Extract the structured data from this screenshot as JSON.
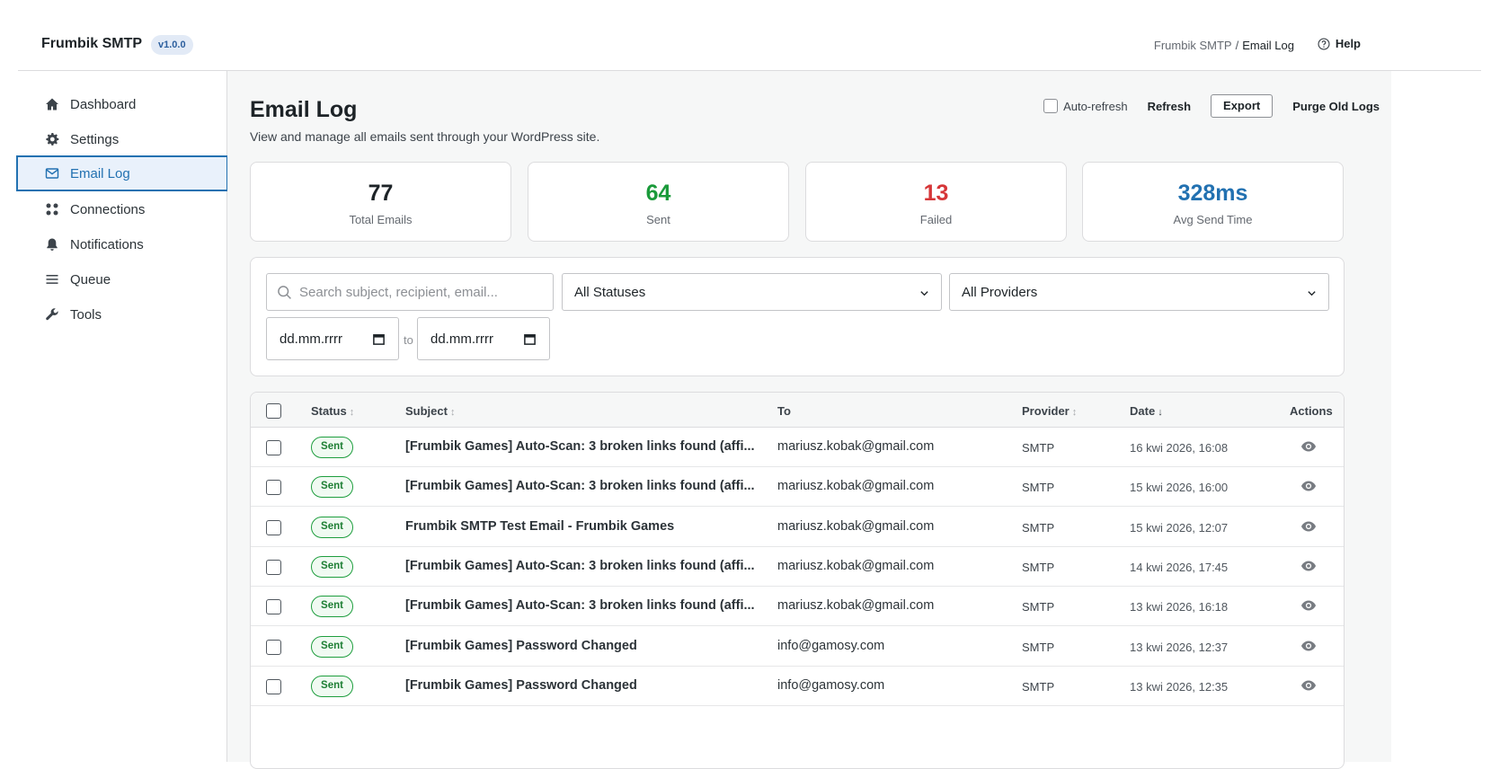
{
  "header": {
    "brand": "Frumbik SMTP",
    "version": "v1.0.0",
    "breadcrumb_root": "Frumbik SMTP",
    "breadcrumb_sep": "/",
    "breadcrumb_current": "Email Log",
    "help": "Help"
  },
  "sidebar": {
    "items": [
      {
        "label": "Dashboard",
        "icon": "home-icon"
      },
      {
        "label": "Settings",
        "icon": "gear-icon"
      },
      {
        "label": "Email Log",
        "icon": "envelope-icon",
        "active": true
      },
      {
        "label": "Connections",
        "icon": "connections-icon"
      },
      {
        "label": "Notifications",
        "icon": "bell-icon"
      },
      {
        "label": "Queue",
        "icon": "list-icon"
      },
      {
        "label": "Tools",
        "icon": "wrench-icon"
      }
    ]
  },
  "page": {
    "title": "Email Log",
    "subtitle": "View and manage all emails sent through your WordPress site.",
    "auto_refresh": "Auto-refresh",
    "refresh": "Refresh",
    "export": "Export",
    "purge": "Purge Old Logs"
  },
  "stats": [
    {
      "value": "77",
      "label": "Total Emails",
      "color": "#1d2327"
    },
    {
      "value": "64",
      "label": "Sent",
      "color": "#1a9a3a"
    },
    {
      "value": "13",
      "label": "Failed",
      "color": "#d63638"
    },
    {
      "value": "328ms",
      "label": "Avg Send Time",
      "color": "#2271b1"
    }
  ],
  "filters": {
    "search_placeholder": "Search subject, recipient, email...",
    "status": "All Statuses",
    "provider": "All Providers",
    "date_from": "dd.mm.rrrr",
    "date_to": "dd.mm.rrrr",
    "to_label": "to"
  },
  "table": {
    "headers": {
      "status": "Status",
      "subject": "Subject",
      "to": "To",
      "provider": "Provider",
      "date": "Date",
      "actions": "Actions",
      "sort_neutral": "↕",
      "sort_desc": "↓"
    },
    "rows": [
      {
        "status": "Sent",
        "subject": "[Frumbik Games] Auto-Scan: 3 broken links found (affi...",
        "to": "mariusz.kobak@gmail.com",
        "provider": "SMTP",
        "date": "16 kwi 2026, 16:08"
      },
      {
        "status": "Sent",
        "subject": "[Frumbik Games] Auto-Scan: 3 broken links found (affi...",
        "to": "mariusz.kobak@gmail.com",
        "provider": "SMTP",
        "date": "15 kwi 2026, 16:00"
      },
      {
        "status": "Sent",
        "subject": "Frumbik SMTP Test Email - Frumbik Games",
        "to": "mariusz.kobak@gmail.com",
        "provider": "SMTP",
        "date": "15 kwi 2026, 12:07"
      },
      {
        "status": "Sent",
        "subject": "[Frumbik Games] Auto-Scan: 3 broken links found (affi...",
        "to": "mariusz.kobak@gmail.com",
        "provider": "SMTP",
        "date": "14 kwi 2026, 17:45"
      },
      {
        "status": "Sent",
        "subject": "[Frumbik Games] Auto-Scan: 3 broken links found (affi...",
        "to": "mariusz.kobak@gmail.com",
        "provider": "SMTP",
        "date": "13 kwi 2026, 16:18"
      },
      {
        "status": "Sent",
        "subject": "[Frumbik Games] Password Changed",
        "to": "info@gamosy.com",
        "provider": "SMTP",
        "date": "13 kwi 2026, 12:37"
      },
      {
        "status": "Sent",
        "subject": "[Frumbik Games] Password Changed",
        "to": "info@gamosy.com",
        "provider": "SMTP",
        "date": "13 kwi 2026, 12:35"
      }
    ]
  }
}
